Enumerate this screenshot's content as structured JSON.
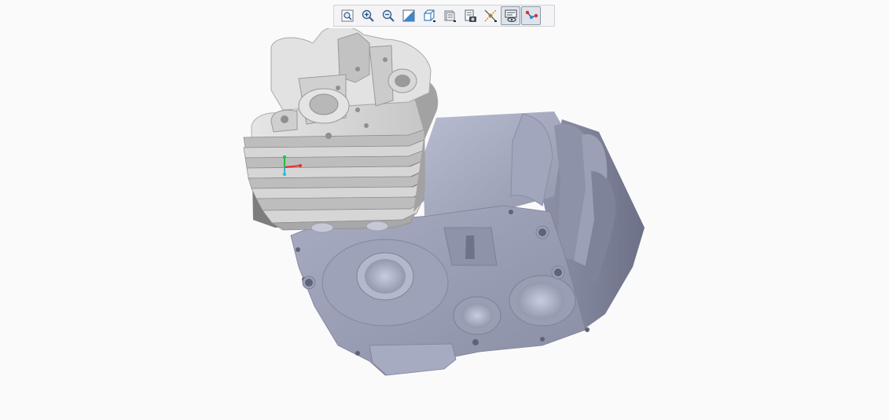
{
  "toolbar": {
    "buttons": [
      {
        "id": "refit",
        "icon": "refit-icon",
        "active": false
      },
      {
        "id": "zoom-in",
        "icon": "zoom-in-icon",
        "active": false
      },
      {
        "id": "zoom-out",
        "icon": "zoom-out-icon",
        "active": false
      },
      {
        "id": "repaint",
        "icon": "repaint-icon",
        "active": false
      },
      {
        "id": "display-style",
        "icon": "display-style-icon",
        "active": false
      },
      {
        "id": "saved-orientations",
        "icon": "saved-orientations-icon",
        "active": false
      },
      {
        "id": "view-manager",
        "icon": "view-manager-icon",
        "active": false
      },
      {
        "id": "datum-display",
        "icon": "datum-display-icon",
        "active": false
      },
      {
        "id": "spin-center",
        "icon": "spin-center-icon",
        "active": true
      },
      {
        "id": "annotation-display",
        "icon": "annotation-display-icon",
        "active": true
      }
    ]
  },
  "model": {
    "parts": [
      "engine-crankcase",
      "cylinder-head"
    ],
    "colors": {
      "crankcase": "#a4a8bf",
      "crankcase_dark": "#7d8197",
      "head": "#d8d8d8",
      "head_dark": "#9c9c9c",
      "axis_x": "#e03030",
      "axis_y": "#20c040",
      "axis_z": "#20c0d0"
    }
  }
}
